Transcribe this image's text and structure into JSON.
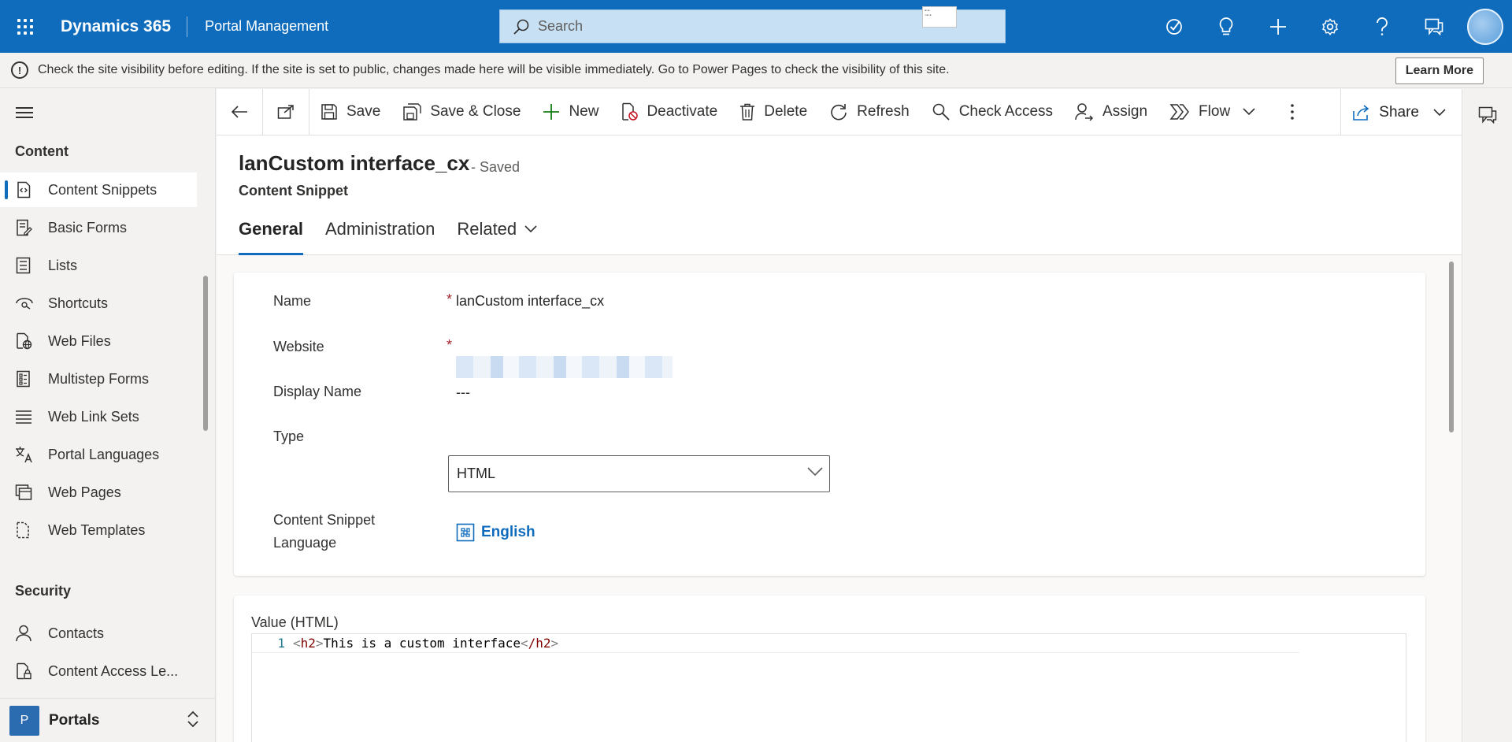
{
  "topbar": {
    "brand": "Dynamics 365",
    "app_name": "Portal Management",
    "search_placeholder": "Search",
    "icons": [
      "task-check-icon",
      "lightbulb-icon",
      "plus-icon",
      "gear-icon",
      "help-icon",
      "chat-icon",
      "avatar"
    ]
  },
  "notice": {
    "message": "Check the site visibility before editing. If the site is set to public, changes made here will be visible immediately. Go to Power Pages to check the visibility of this site.",
    "learn_more": "Learn More"
  },
  "sidebar": {
    "content_title": "Content",
    "content_items": [
      {
        "label": "Content Snippets",
        "icon": "snippet-icon",
        "active": true
      },
      {
        "label": "Basic Forms",
        "icon": "form-icon"
      },
      {
        "label": "Lists",
        "icon": "list-icon"
      },
      {
        "label": "Shortcuts",
        "icon": "shortcut-icon"
      },
      {
        "label": "Web Files",
        "icon": "web-file-icon"
      },
      {
        "label": "Multistep Forms",
        "icon": "multistep-form-icon"
      },
      {
        "label": "Web Link Sets",
        "icon": "link-set-icon"
      },
      {
        "label": "Portal Languages",
        "icon": "language-icon"
      },
      {
        "label": "Web Pages",
        "icon": "web-page-icon"
      },
      {
        "label": "Web Templates",
        "icon": "template-icon"
      }
    ],
    "security_title": "Security",
    "security_items": [
      {
        "label": "Contacts",
        "icon": "contact-icon"
      },
      {
        "label": "Content Access Le...",
        "icon": "access-level-icon"
      }
    ],
    "area_badge": "P",
    "area_label": "Portals"
  },
  "commands": {
    "save": "Save",
    "save_close": "Save & Close",
    "new": "New",
    "deactivate": "Deactivate",
    "delete": "Delete",
    "refresh": "Refresh",
    "check_access": "Check Access",
    "assign": "Assign",
    "flow": "Flow",
    "share": "Share"
  },
  "record": {
    "title": "lanCustom interface_cx",
    "status": "- Saved",
    "entity": "Content Snippet",
    "tabs": [
      "General",
      "Administration",
      "Related"
    ]
  },
  "form": {
    "name_label": "Name",
    "name_value": "lanCustom interface_cx",
    "website_label": "Website",
    "display_name_label": "Display Name",
    "display_name_value": "---",
    "type_label": "Type",
    "type_value": "HTML",
    "language_label_line1": "Content Snippet",
    "language_label_line2": "Language",
    "language_value": "English",
    "required_mark": "*"
  },
  "editor": {
    "label": "Value (HTML)",
    "line_number": "1",
    "open_tag": "h2",
    "text": "This is a custom interface",
    "close_tag": "/h2"
  },
  "colors": {
    "brand_blue": "#0f6cbd",
    "required_red": "#a4262c",
    "new_green": "#107c10"
  }
}
